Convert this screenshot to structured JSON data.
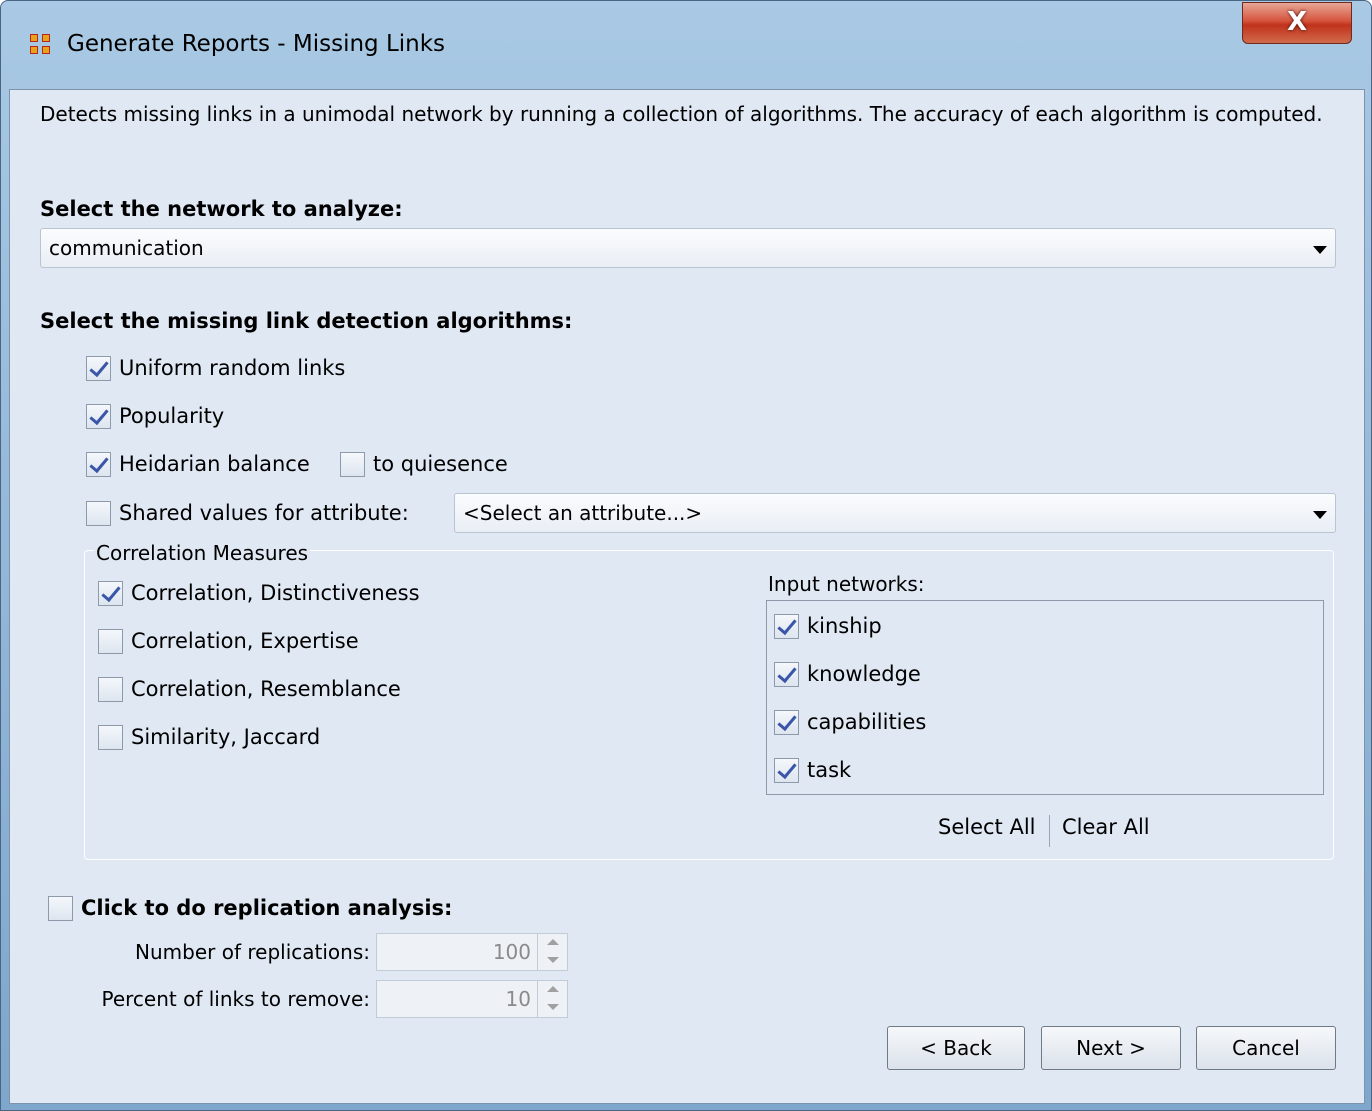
{
  "window": {
    "title": "Generate Reports - Missing Links",
    "close_label": "X"
  },
  "description": "Detects missing links in a unimodal network by running a collection of algorithms. The accuracy of each algorithm is computed.",
  "network": {
    "label": "Select the network to analyze:",
    "selected": "communication"
  },
  "algorithms": {
    "label": "Select the missing link detection algorithms:",
    "uniform": {
      "label": "Uniform random links",
      "checked": true
    },
    "popularity": {
      "label": "Popularity",
      "checked": true
    },
    "heidarian": {
      "label": "Heidarian balance",
      "checked": true
    },
    "quiesence": {
      "label": "to quiesence",
      "checked": false
    },
    "shared": {
      "label": "Shared values for attribute:",
      "checked": false,
      "attribute_selected": "<Select an attribute...>"
    }
  },
  "correlation": {
    "title": "Correlation Measures",
    "items": [
      {
        "label": "Correlation, Distinctiveness",
        "checked": true
      },
      {
        "label": "Correlation, Expertise",
        "checked": false
      },
      {
        "label": "Correlation, Resemblance",
        "checked": false
      },
      {
        "label": "Similarity, Jaccard",
        "checked": false
      }
    ],
    "input_networks_label": "Input networks:",
    "networks": [
      {
        "label": "kinship",
        "checked": true
      },
      {
        "label": "knowledge",
        "checked": true
      },
      {
        "label": "capabilities",
        "checked": true
      },
      {
        "label": "task",
        "checked": true
      }
    ],
    "select_all": "Select All",
    "clear_all": "Clear All"
  },
  "replication": {
    "label": "Click to do replication analysis:",
    "checked": false,
    "num_label": "Number of replications:",
    "num_value": "100",
    "pct_label": "Percent of links to remove:",
    "pct_value": "10"
  },
  "buttons": {
    "back": "< Back",
    "next": "Next >",
    "cancel": "Cancel"
  }
}
